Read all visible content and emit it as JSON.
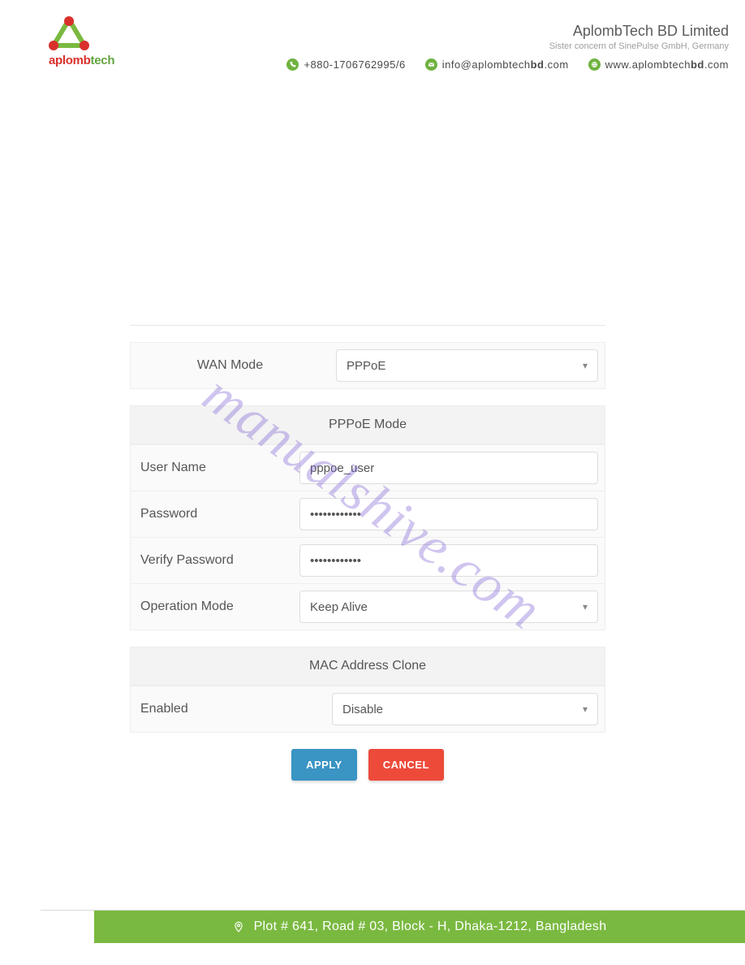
{
  "header": {
    "logo_text_left": "aplomb",
    "logo_text_right": "tech",
    "company_name": "AplombTech BD Limited",
    "company_sub": "Sister concern of SinePulse GmbH, Germany",
    "contacts": {
      "phone": "+880-1706762995/6",
      "email_pre": "info@aplombtech",
      "email_bold": "bd",
      "email_post": ".com",
      "web_pre": "www.aplombtech",
      "web_bold": "bd",
      "web_post": ".com"
    }
  },
  "form": {
    "wan_mode_label": "WAN Mode",
    "wan_mode_value": "PPPoE",
    "pppoe_section": "PPPoE Mode",
    "username_label": "User Name",
    "username_value": "pppoe_user",
    "password_label": "Password",
    "password_value": "••••••••••••",
    "verify_label": "Verify Password",
    "verify_value": "••••••••••••",
    "opmode_label": "Operation Mode",
    "opmode_value": "Keep Alive",
    "mac_section": "MAC Address Clone",
    "enabled_label": "Enabled",
    "enabled_value": "Disable",
    "apply": "APPLY",
    "cancel": "CANCEL"
  },
  "watermark": "manualshive.com",
  "footer": {
    "address": "Plot # 641, Road # 03, Block - H, Dhaka-1212, Bangladesh"
  }
}
